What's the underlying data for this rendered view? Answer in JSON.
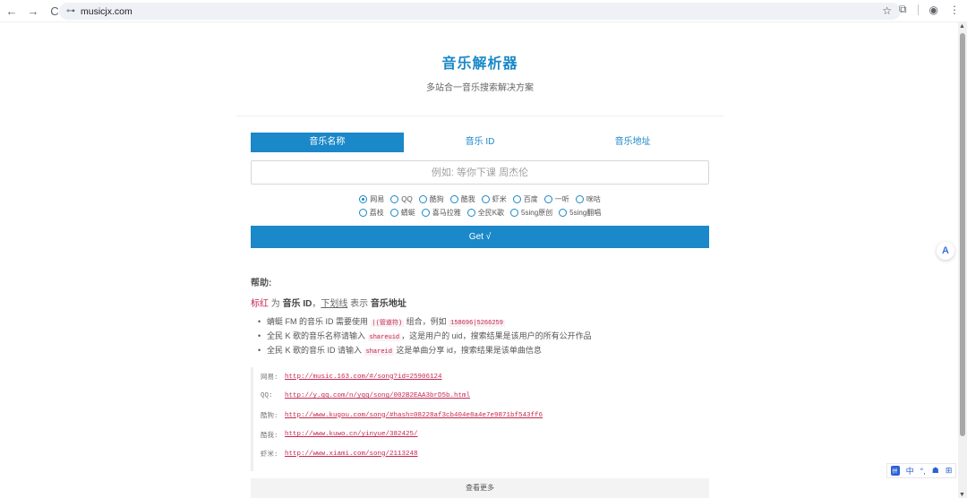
{
  "browser": {
    "url": "musicjx.com",
    "nav": {
      "back": "←",
      "forward": "→",
      "reload": "C"
    },
    "icons": {
      "star": "☆",
      "extensions": "⧉",
      "profile": "◉",
      "menu": "⋮",
      "site_settings": "⊶"
    }
  },
  "header": {
    "title": "音乐解析器",
    "subtitle": "多站合一音乐搜索解决方案"
  },
  "tabs": [
    {
      "label": "音乐名称",
      "active": true
    },
    {
      "label": "音乐 ID",
      "active": false
    },
    {
      "label": "音乐地址",
      "active": false
    }
  ],
  "search": {
    "placeholder": "例如: 等你下课 周杰伦",
    "value": ""
  },
  "sources_row1": [
    {
      "label": "网易",
      "checked": true
    },
    {
      "label": "QQ",
      "checked": false
    },
    {
      "label": "酷狗",
      "checked": false
    },
    {
      "label": "酷我",
      "checked": false
    },
    {
      "label": "虾米",
      "checked": false
    },
    {
      "label": "百度",
      "checked": false
    },
    {
      "label": "一听",
      "checked": false
    },
    {
      "label": "咪咕",
      "checked": false
    }
  ],
  "sources_row2": [
    {
      "label": "荔枝",
      "checked": false
    },
    {
      "label": "蜻蜓",
      "checked": false
    },
    {
      "label": "喜马拉雅",
      "checked": false
    },
    {
      "label": "全民K歌",
      "checked": false
    },
    {
      "label": "5sing原创",
      "checked": false
    },
    {
      "label": "5sing翻唱",
      "checked": false
    }
  ],
  "get_button": "Get √",
  "help": {
    "title": "帮助:",
    "legend": {
      "red_word": "标红",
      "t1": " 为 ",
      "id_word": "音乐 ID",
      "t2": "，",
      "underline_word": "下划线",
      "t3": " 表示 ",
      "addr_word": "音乐地址"
    },
    "items": [
      {
        "pre": "蜻蜓 FM 的音乐 ID 需要使用 ",
        "code1": "|(管道符)",
        "mid": " 组合，例如 ",
        "code2": "158696|5266259",
        "post": ""
      },
      {
        "pre": "全民 K 歌的音乐名称请输入 ",
        "code1": "shareuid",
        "mid": "，这是用户的 uid，搜索结果是该用户的所有公开作品",
        "code2": "",
        "post": ""
      },
      {
        "pre": "全民 K 歌的音乐 ID 请输入 ",
        "code1": "shareid",
        "mid": " 这是单曲分享 id，搜索结果是该单曲信息",
        "code2": "",
        "post": ""
      }
    ]
  },
  "examples": [
    {
      "label": "网易:",
      "url": "http://music.163.com/#/song?id=25906124"
    },
    {
      "label": "QQ:",
      "url": "http://y.qq.com/n/yqq/song/002B2EAA3brD5b.html"
    },
    {
      "label": "酷狗:",
      "url": "http://www.kugou.com/song/#hash=08228af3cb404e8a4e7e9871bf543ff6"
    },
    {
      "label": "酷我:",
      "url": "http://www.kuwo.cn/yinyue/382425/"
    },
    {
      "label": "虾米:",
      "url": "http://www.xiami.com/song/2113248"
    }
  ],
  "more_button": "查看更多",
  "ime": {
    "logo": "拼",
    "lang": "中",
    "punct": "°,",
    "skin": "☗",
    "grid": "⊞"
  },
  "float_icon": "A",
  "colors": {
    "accent": "#1a88c9",
    "code": "#c7254e"
  }
}
